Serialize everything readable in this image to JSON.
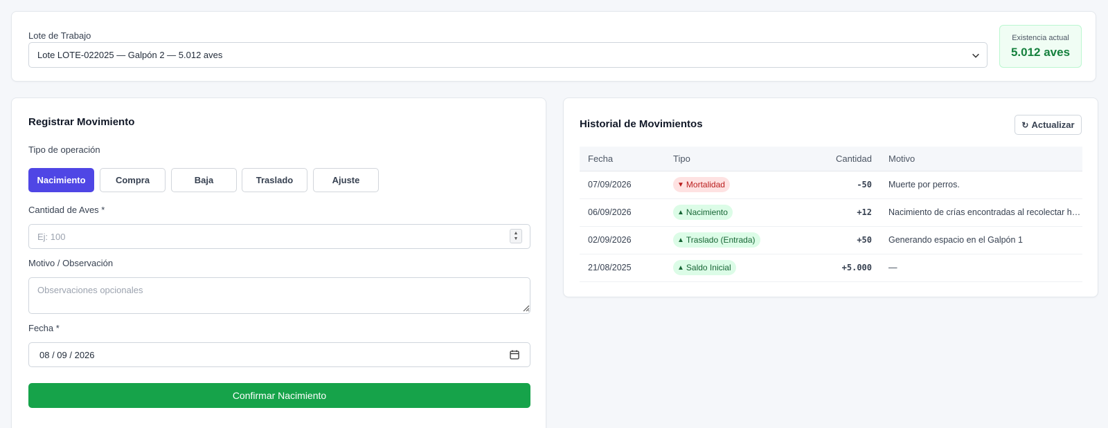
{
  "top": {
    "lote_label": "Lote de Trabajo",
    "lote_selected": "Lote LOTE-022025 — Galpón 2 — 5.012 aves",
    "existencia_label": "Existencia actual",
    "existencia_value": "5.012 aves"
  },
  "form": {
    "title": "Registrar Movimiento",
    "tipo_label": "Tipo de operación",
    "operations": [
      {
        "label": "Nacimiento",
        "active": true
      },
      {
        "label": "Compra",
        "active": false
      },
      {
        "label": "Baja",
        "active": false
      },
      {
        "label": "Traslado",
        "active": false
      },
      {
        "label": "Ajuste",
        "active": false
      }
    ],
    "cantidad_label": "Cantidad de Aves *",
    "cantidad_placeholder": "Ej: 100",
    "motivo_label": "Motivo / Observación",
    "motivo_placeholder": "Observaciones opcionales",
    "fecha_label": "Fecha *",
    "fecha_value": "08 / 09 / 2026",
    "confirm_label": "Confirmar Nacimiento"
  },
  "history": {
    "title": "Historial de Movimientos",
    "refresh_label": "Actualizar",
    "columns": [
      "Fecha",
      "Tipo",
      "Cantidad",
      "Motivo"
    ],
    "rows": [
      {
        "fecha": "07/09/2026",
        "tipo": "Mortalidad",
        "direction": "down",
        "cantidad": "-50",
        "motivo": "Muerte por perros."
      },
      {
        "fecha": "06/09/2026",
        "tipo": "Nacimiento",
        "direction": "up",
        "cantidad": "+12",
        "motivo": "Nacimiento de crías encontradas al recolectar huevos"
      },
      {
        "fecha": "02/09/2026",
        "tipo": "Traslado (Entrada)",
        "direction": "up",
        "cantidad": "+50",
        "motivo": "Generando espacio en el Galpón 1"
      },
      {
        "fecha": "21/08/2025",
        "tipo": "Saldo Inicial",
        "direction": "up",
        "cantidad": "+5.000",
        "motivo": "—"
      }
    ]
  },
  "colors": {
    "primary": "#4f46e5",
    "success": "#16a34a",
    "danger": "#b91c1c"
  }
}
